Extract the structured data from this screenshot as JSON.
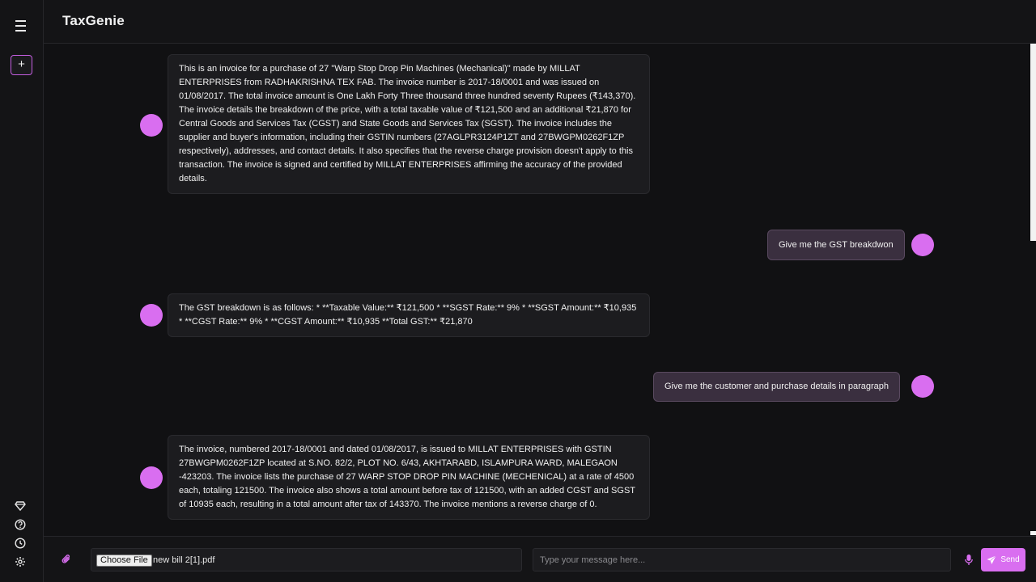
{
  "app": {
    "title": "TaxGenie"
  },
  "sidebar": {
    "new_chat_label": "+",
    "icons": [
      "diamond-icon",
      "help-icon",
      "history-icon",
      "settings-icon"
    ]
  },
  "messages": [
    {
      "role": "bot",
      "text": "This is an invoice for a purchase of 27 \"Warp Stop Drop Pin Machines (Mechanical)\" made by MILLAT ENTERPRISES from RADHAKRISHNA TEX FAB. The invoice number is 2017-18/0001 and was issued on 01/08/2017. The total invoice amount is One Lakh Forty Three thousand three hundred seventy Rupees (₹143,370). The invoice details the breakdown of the price, with a total taxable value of ₹121,500 and an additional ₹21,870 for Central Goods and Services Tax (CGST) and State Goods and Services Tax (SGST). The invoice includes the supplier and buyer's information, including their GSTIN numbers (27AGLPR3124P1ZT and 27BWGPM0262F1ZP respectively), addresses, and contact details. It also specifies that the reverse charge provision doesn't apply to this transaction. The invoice is signed and certified by MILLAT ENTERPRISES affirming the accuracy of the provided details."
    },
    {
      "role": "user",
      "text": "Give me the GST breakdwon"
    },
    {
      "role": "bot",
      "text": "The GST breakdown is as follows: * **Taxable Value:** ₹121,500 * **SGST Rate:** 9% * **SGST Amount:** ₹10,935 * **CGST Rate:** 9% * **CGST Amount:** ₹10,935 **Total GST:** ₹21,870"
    },
    {
      "role": "user",
      "text": "Give me the customer and purchase details in paragraph"
    },
    {
      "role": "bot",
      "text": "The invoice, numbered 2017-18/0001 and dated 01/08/2017, is issued to MILLAT ENTERPRISES with GSTIN 27BWGPM0262F1ZP located at S.NO. 82/2, PLOT NO. 6/43, AKHTARABD, ISLAMPURA WARD, MALEGAON -423203. The invoice lists the purchase of 27 WARP STOP DROP PIN MACHINE (MECHENICAL) at a rate of 4500 each, totaling 121500. The invoice also shows a total amount before tax of 121500, with an added CGST and SGST of 10935 each, resulting in a total amount after tax of 143370. The invoice mentions a reverse charge of 0."
    }
  ],
  "input": {
    "choose_file_label": "Choose File",
    "file_name": "new bill 2[1].pdf",
    "message_placeholder": "Type your message here...",
    "send_label": "Send"
  },
  "colors": {
    "accent": "#d96ef0",
    "background": "#111113",
    "bot_bubble": "#1c1c1f",
    "user_bubble": "#3a2f3f"
  }
}
